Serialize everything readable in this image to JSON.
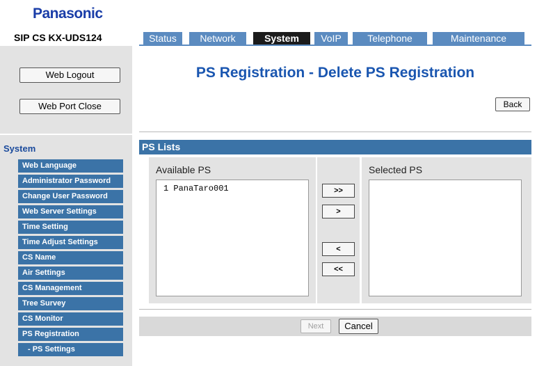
{
  "brand": "Panasonic",
  "model": "SIP CS KX-UDS124",
  "tabs": [
    {
      "label": "Status",
      "active": false
    },
    {
      "label": "Network",
      "active": false
    },
    {
      "label": "System",
      "active": true
    },
    {
      "label": "VoIP",
      "active": false
    },
    {
      "label": "Telephone",
      "active": false
    },
    {
      "label": "Maintenance",
      "active": false
    }
  ],
  "sidebar": {
    "logout_label": "Web Logout",
    "port_close_label": "Web Port Close",
    "section_label": "System",
    "items": [
      "Web Language",
      "Administrator Password",
      "Change User Password",
      "Web Server Settings",
      "Time Setting",
      "Time Adjust Settings",
      "CS Name",
      "Air Settings",
      "CS Management",
      "Tree Survey",
      "CS Monitor",
      "PS Registration",
      "- PS Settings"
    ]
  },
  "main": {
    "title": "PS Registration - Delete PS Registration",
    "back_label": "Back",
    "section_title": "PS Lists",
    "available_label": "Available PS",
    "selected_label": "Selected PS",
    "available_items": [
      "1 PanaTaro001"
    ],
    "selected_items": [],
    "move_all_right": ">>",
    "move_right": ">",
    "move_left": "<",
    "move_all_left": "<<",
    "next_label": "Next",
    "cancel_label": "Cancel"
  },
  "colors": {
    "brand": "#1a3da8",
    "tab_bg": "#5b8bc0",
    "tab_active_bg": "#1b1b1b",
    "menu_bg": "#3b73a7",
    "title": "#1a56b0",
    "panel_bg": "#e3e3e3"
  }
}
